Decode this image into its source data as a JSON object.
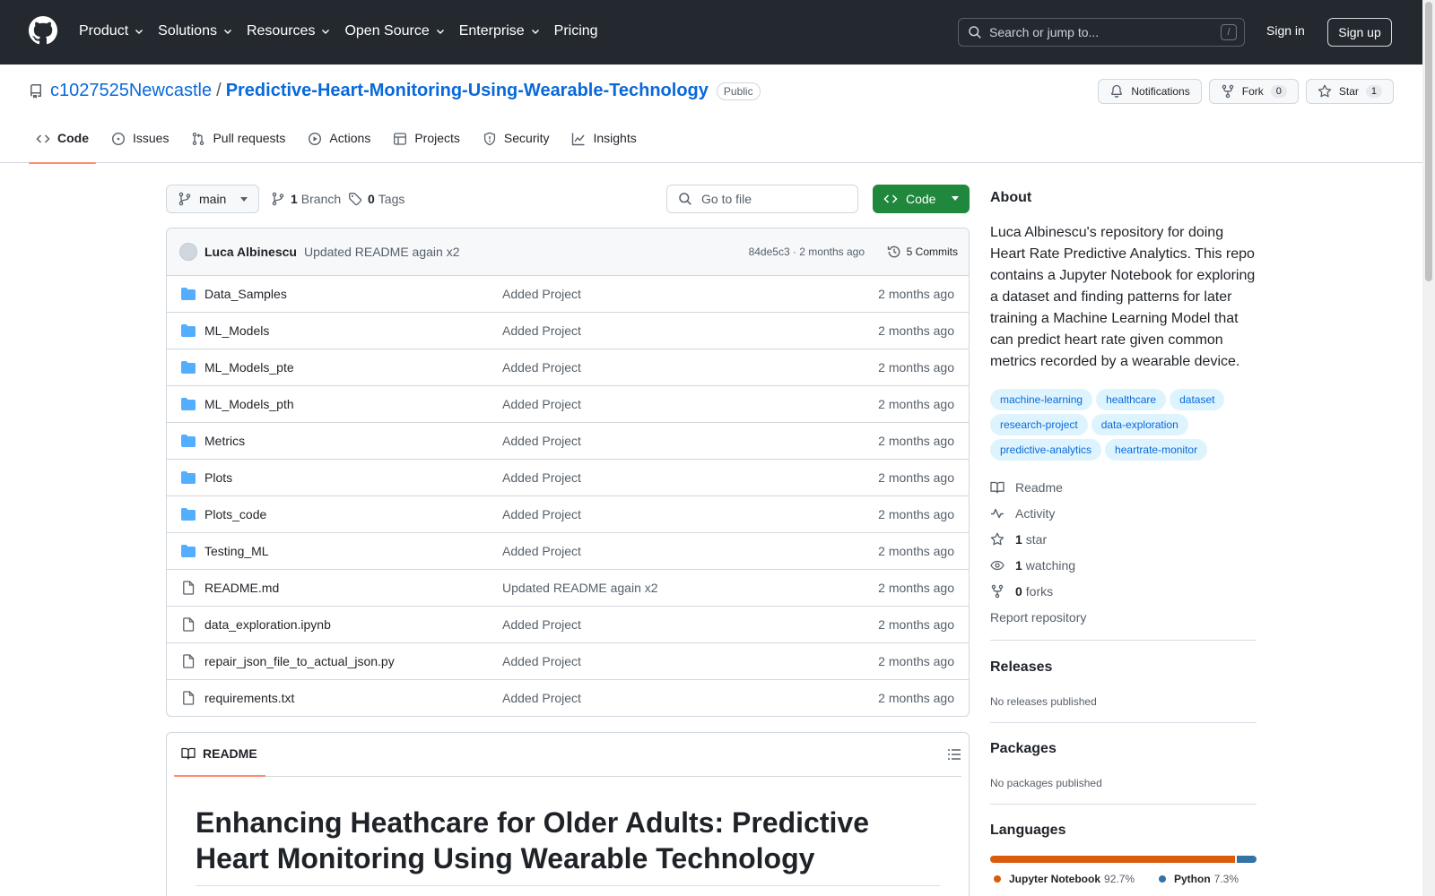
{
  "header": {
    "nav": [
      {
        "label": "Product",
        "has_menu": true
      },
      {
        "label": "Solutions",
        "has_menu": true
      },
      {
        "label": "Resources",
        "has_menu": true
      },
      {
        "label": "Open Source",
        "has_menu": true
      },
      {
        "label": "Enterprise",
        "has_menu": true
      },
      {
        "label": "Pricing",
        "has_menu": false
      }
    ],
    "search_placeholder": "Search or jump to...",
    "search_shortcut": "/",
    "sign_in": "Sign in",
    "sign_up": "Sign up"
  },
  "repo": {
    "owner": "c1027525Newcastle",
    "separator": "/",
    "name": "Predictive-Heart-Monitoring-Using-Wearable-Technology",
    "visibility": "Public",
    "notifications_label": "Notifications",
    "fork_label": "Fork",
    "fork_count": "0",
    "star_label": "Star",
    "star_count": "1"
  },
  "tabs": [
    {
      "label": "Code",
      "icon": "code-icon",
      "active": true
    },
    {
      "label": "Issues",
      "icon": "issue-opened-icon",
      "active": false
    },
    {
      "label": "Pull requests",
      "icon": "git-pull-request-icon",
      "active": false
    },
    {
      "label": "Actions",
      "icon": "play-icon",
      "active": false
    },
    {
      "label": "Projects",
      "icon": "table-icon",
      "active": false
    },
    {
      "label": "Security",
      "icon": "shield-icon",
      "active": false
    },
    {
      "label": "Insights",
      "icon": "graph-icon",
      "active": false
    }
  ],
  "toolbar": {
    "branch": "main",
    "branch_count": "1",
    "branch_label": "Branch",
    "tag_count": "0",
    "tag_label": "Tags",
    "goto_placeholder": "Go to file",
    "code_button": "Code"
  },
  "latest_commit": {
    "author": "Luca Albinescu",
    "message": "Updated README again x2",
    "meta": "84de5c3 · 2 months ago",
    "commits_label": "5 Commits"
  },
  "files": [
    {
      "name": "Data_Samples",
      "type": "dir",
      "message": "Added Project",
      "age": "2 months ago"
    },
    {
      "name": "ML_Models",
      "type": "dir",
      "message": "Added Project",
      "age": "2 months ago"
    },
    {
      "name": "ML_Models_pte",
      "type": "dir",
      "message": "Added Project",
      "age": "2 months ago"
    },
    {
      "name": "ML_Models_pth",
      "type": "dir",
      "message": "Added Project",
      "age": "2 months ago"
    },
    {
      "name": "Metrics",
      "type": "dir",
      "message": "Added Project",
      "age": "2 months ago"
    },
    {
      "name": "Plots",
      "type": "dir",
      "message": "Added Project",
      "age": "2 months ago"
    },
    {
      "name": "Plots_code",
      "type": "dir",
      "message": "Added Project",
      "age": "2 months ago"
    },
    {
      "name": "Testing_ML",
      "type": "dir",
      "message": "Added Project",
      "age": "2 months ago"
    },
    {
      "name": "README.md",
      "type": "file",
      "message": "Updated README again x2",
      "age": "2 months ago"
    },
    {
      "name": "data_exploration.ipynb",
      "type": "file",
      "message": "Added Project",
      "age": "2 months ago"
    },
    {
      "name": "repair_json_file_to_actual_json.py",
      "type": "file",
      "message": "Added Project",
      "age": "2 months ago"
    },
    {
      "name": "requirements.txt",
      "type": "file",
      "message": "Added Project",
      "age": "2 months ago"
    }
  ],
  "readme": {
    "tab_label": "README",
    "heading": "Enhancing Heathcare for Older Adults: Predictive Heart Monitoring Using Wearable Technology"
  },
  "about": {
    "heading": "About",
    "description": "Luca Albinescu's repository for doing Heart Rate Predictive Analytics. This repo contains a Jupyter Notebook for exploring a dataset and finding patterns for later training a Machine Learning Model that can predict heart rate given common metrics recorded by a wearable device.",
    "topics": [
      "machine-learning",
      "healthcare",
      "dataset",
      "research-project",
      "data-exploration",
      "predictive-analytics",
      "heartrate-monitor"
    ],
    "readme_label": "Readme",
    "activity_label": "Activity",
    "stars_count": "1",
    "stars_label": "star",
    "watching_count": "1",
    "watching_label": "watching",
    "forks_count": "0",
    "forks_label": "forks",
    "report_label": "Report repository"
  },
  "releases": {
    "heading": "Releases",
    "note": "No releases published"
  },
  "packages": {
    "heading": "Packages",
    "note": "No packages published"
  },
  "languages": {
    "heading": "Languages",
    "items": [
      {
        "name": "Jupyter Notebook",
        "percent": "92.7%",
        "value": 92.7,
        "color": "#DA5B0B"
      },
      {
        "name": "Python",
        "percent": "7.3%",
        "value": 7.3,
        "color": "#3572A5"
      }
    ]
  },
  "colors": {
    "header_bg": "#24292f",
    "link": "#0969da",
    "primary_button": "#1f883d",
    "folder": "#54aeff",
    "active_tab_underline": "#fd8c73"
  }
}
